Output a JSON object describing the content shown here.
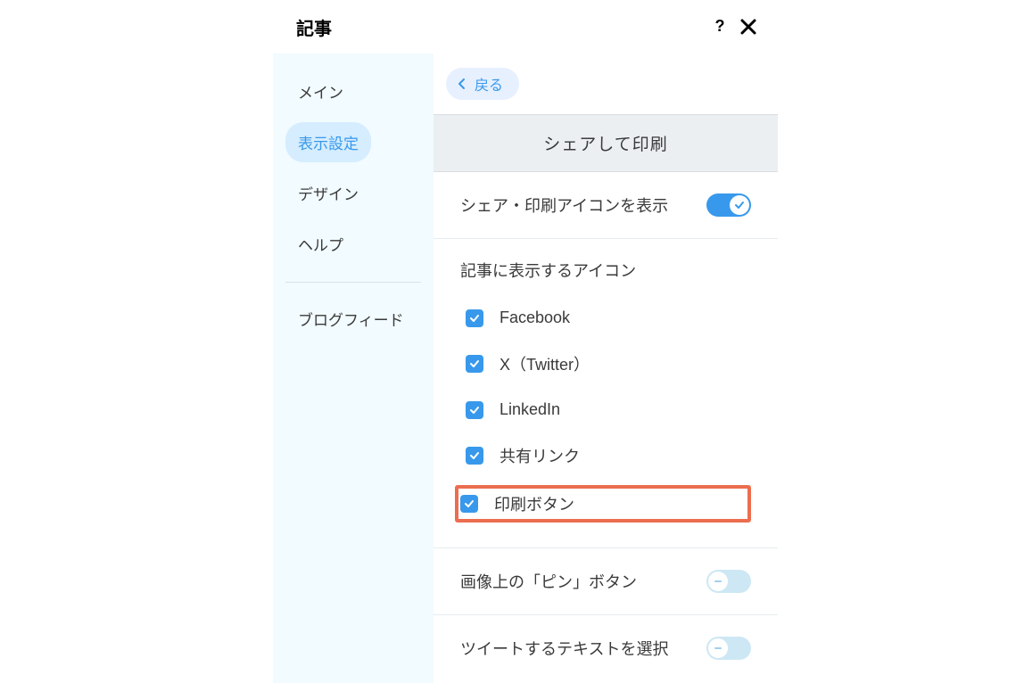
{
  "header": {
    "title": "記事"
  },
  "sidebar": {
    "items": [
      {
        "label": "メイン",
        "active": false
      },
      {
        "label": "表示設定",
        "active": true
      },
      {
        "label": "デザイン",
        "active": false
      },
      {
        "label": "ヘルプ",
        "active": false
      }
    ],
    "secondary": [
      {
        "label": "ブログフィード"
      }
    ]
  },
  "content": {
    "back_label": "戻る",
    "section_title": "シェアして印刷",
    "share_print_toggle": {
      "label": "シェア・印刷アイコンを表示",
      "enabled": true
    },
    "icons_section": {
      "title": "記事に表示するアイコン",
      "options": [
        {
          "label": "Facebook",
          "checked": true,
          "highlighted": false
        },
        {
          "label": "X（Twitter）",
          "checked": true,
          "highlighted": false
        },
        {
          "label": "LinkedIn",
          "checked": true,
          "highlighted": false
        },
        {
          "label": "共有リンク",
          "checked": true,
          "highlighted": false
        },
        {
          "label": "印刷ボタン",
          "checked": true,
          "highlighted": true
        }
      ]
    },
    "pin_toggle": {
      "label": "画像上の「ピン」ボタン",
      "enabled": false
    },
    "tweet_text_toggle": {
      "label": "ツイートするテキストを選択",
      "enabled": false
    }
  }
}
